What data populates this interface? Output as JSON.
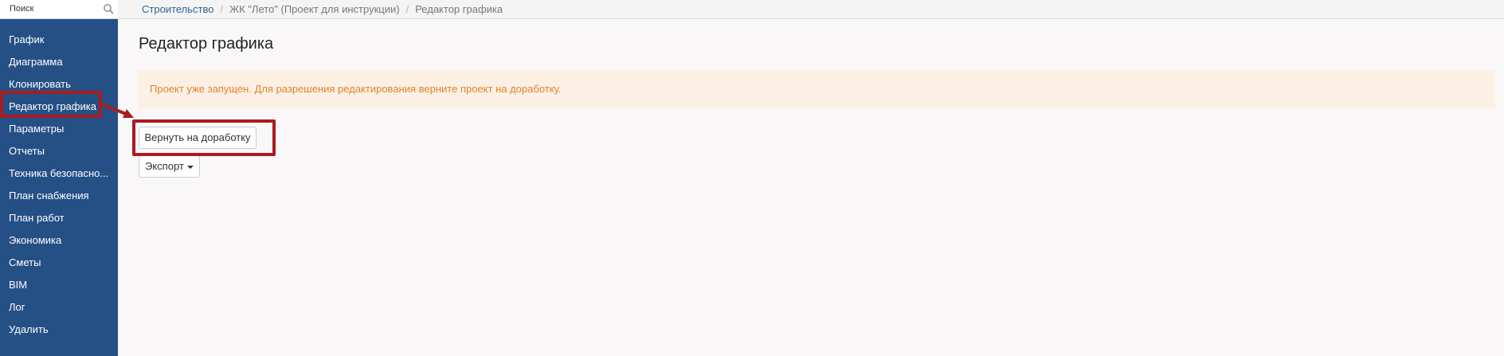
{
  "search": {
    "placeholder": "Поиск",
    "icon": "search-icon"
  },
  "sidebar": {
    "items": [
      {
        "label": "График"
      },
      {
        "label": "Диаграмма"
      },
      {
        "label": "Клонировать"
      },
      {
        "label": "Редактор графика",
        "active": true
      },
      {
        "label": "Параметры"
      },
      {
        "label": "Отчеты"
      },
      {
        "label": "Техника безопасно..."
      },
      {
        "label": "План снабжения"
      },
      {
        "label": "План работ"
      },
      {
        "label": "Экономика"
      },
      {
        "label": "Сметы"
      },
      {
        "label": "BIM"
      },
      {
        "label": "Лог"
      },
      {
        "label": "Удалить"
      }
    ]
  },
  "breadcrumb": {
    "items": [
      "Строительство",
      "ЖК \"Лето\" (Проект для инструкции)",
      "Редактор графика"
    ],
    "separator": "/"
  },
  "main": {
    "title": "Редактор графика",
    "alert": "Проект уже запущен. Для разрешения редактирования верните проект на доработку.",
    "return_button": "Вернуть на доработку",
    "export_button": "Экспорт"
  },
  "colors": {
    "sidebar_bg": "#255086",
    "alert_bg": "#fcf0e4",
    "alert_text": "#e0832c",
    "highlight": "#a81c20",
    "link": "#2a6496"
  }
}
